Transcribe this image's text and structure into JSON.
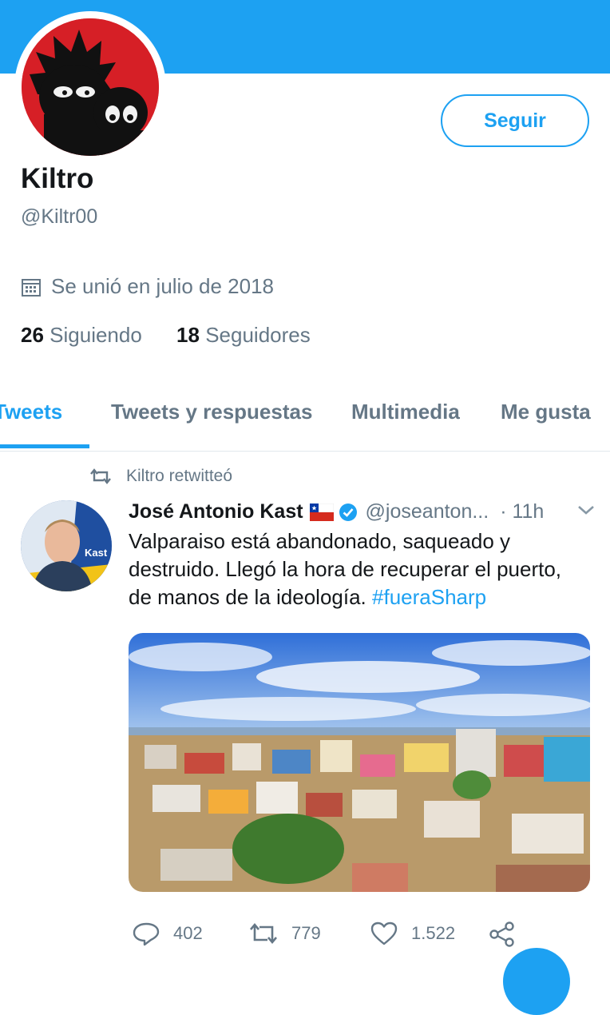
{
  "profile": {
    "name": "Kiltro",
    "handle": "@Kiltr00",
    "joined": "Se unió en julio de 2018",
    "following_count": "26",
    "following_label": "Siguiendo",
    "followers_count": "18",
    "followers_label": "Seguidores",
    "follow_label": "Seguir"
  },
  "tabs": [
    {
      "label": "Tweets",
      "active": true
    },
    {
      "label": "Tweets y respuestas"
    },
    {
      "label": "Multimedia"
    },
    {
      "label": "Me gusta"
    }
  ],
  "tweet": {
    "retweet_note": "Kiltro retwitteó",
    "author": "José Antonio Kast",
    "author_handle": "@joseanton...",
    "time": "· 11h",
    "text": "Valparaiso está abandonado, saqueado y destruido. Llegó la hora de recuperar el puerto, de manos de la ideología.",
    "hashtag": "#fueraSharp",
    "avatar_badge": "Kast",
    "replies": "402",
    "retweets": "779",
    "likes": "1.522"
  },
  "colors": {
    "accent": "#1da1f2",
    "secondary_text": "#657786",
    "primary_text": "#14171a",
    "avatar_bg": "#d61f26"
  },
  "icons": [
    "calendar-icon",
    "retweet-icon",
    "verified-icon",
    "chevron-down-icon",
    "reply-icon",
    "like-icon",
    "share-icon",
    "chile-flag-icon"
  ]
}
